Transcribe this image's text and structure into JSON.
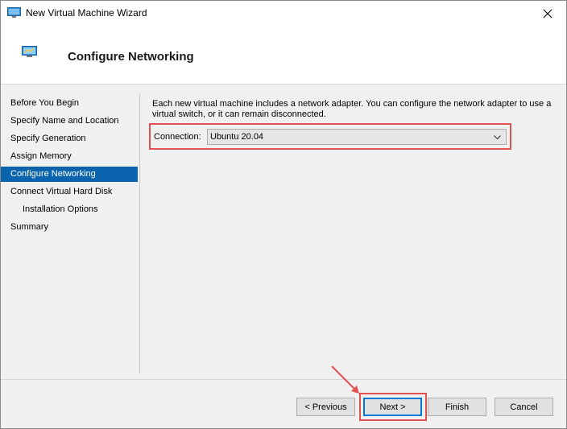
{
  "window": {
    "title": "New Virtual Machine Wizard",
    "icon": "monitor-icon",
    "close_icon": "close-icon"
  },
  "header": {
    "title": "Configure Networking",
    "icon": "network-monitor-icon"
  },
  "sidebar": {
    "items": [
      {
        "label": "Before You Begin",
        "active": false,
        "sub": false
      },
      {
        "label": "Specify Name and Location",
        "active": false,
        "sub": false
      },
      {
        "label": "Specify Generation",
        "active": false,
        "sub": false
      },
      {
        "label": "Assign Memory",
        "active": false,
        "sub": false
      },
      {
        "label": "Configure Networking",
        "active": true,
        "sub": false
      },
      {
        "label": "Connect Virtual Hard Disk",
        "active": false,
        "sub": false
      },
      {
        "label": "Installation Options",
        "active": false,
        "sub": true
      },
      {
        "label": "Summary",
        "active": false,
        "sub": false
      }
    ]
  },
  "content": {
    "description": "Each new virtual machine includes a network adapter. You can configure the network adapter to use a virtual switch, or it can remain disconnected.",
    "connection_label": "Connection:",
    "connection_value": "Ubuntu 20.04"
  },
  "buttons": {
    "previous": "< Previous",
    "next": "Next >",
    "finish": "Finish",
    "cancel": "Cancel"
  },
  "colors": {
    "accent": "#0a64ad",
    "highlight": "#e35252",
    "focus": "#0078d7"
  }
}
